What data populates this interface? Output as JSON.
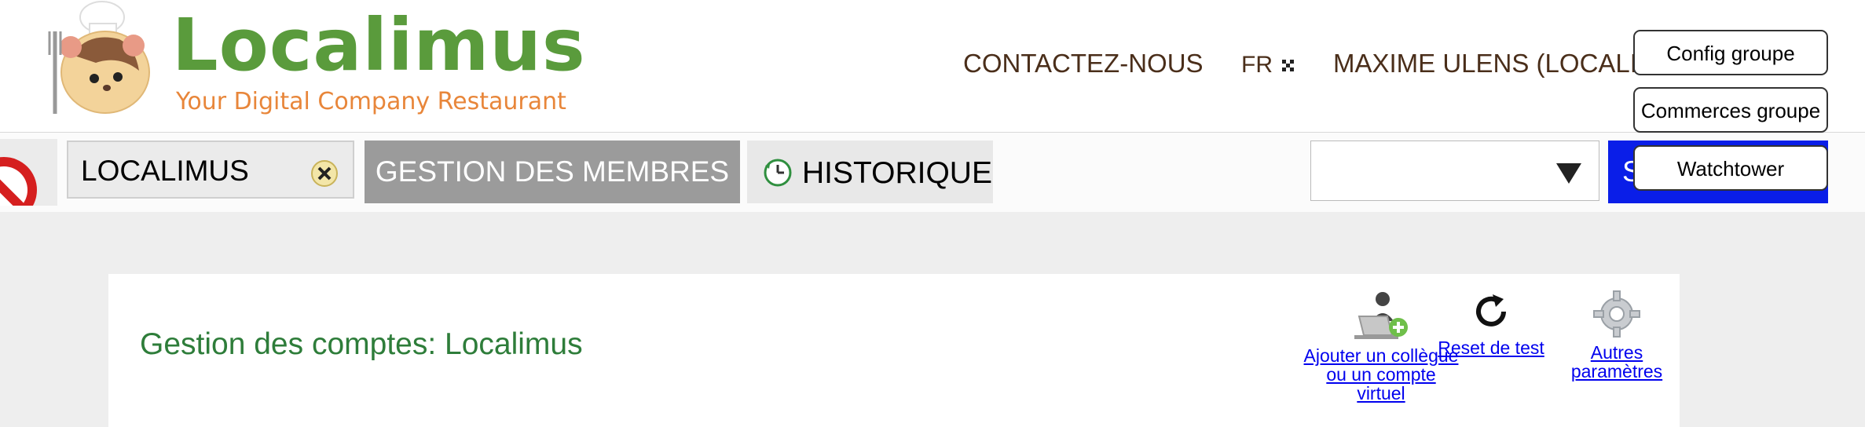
{
  "brand": {
    "name": "Localimus",
    "tagline": "Your Digital Company Restaurant"
  },
  "top_nav": {
    "contact": "CONTACTEZ-NOUS",
    "language": "FR",
    "user": "MAXIME ULENS (LOCALIMUS)"
  },
  "popup_menu": [
    "Config groupe",
    "Commerces groupe",
    "Watchtower"
  ],
  "toolbar": {
    "company_value": "LOCALIMUS",
    "members_label": "GESTION DES MEMBRES",
    "history_label": "HISTORIQUE",
    "select_value": "",
    "blue_button_label": "S"
  },
  "panel": {
    "title": "Gestion des comptes: Localimus",
    "actions": [
      "Ajouter un collègue ou un compte virtuel",
      "Reset de test",
      "Autres paramètres"
    ]
  },
  "colors": {
    "brand_green": "#5a9b3c",
    "brand_orange": "#e8863a",
    "link_blue": "#0000ee",
    "button_blue": "#0a1ee8"
  }
}
